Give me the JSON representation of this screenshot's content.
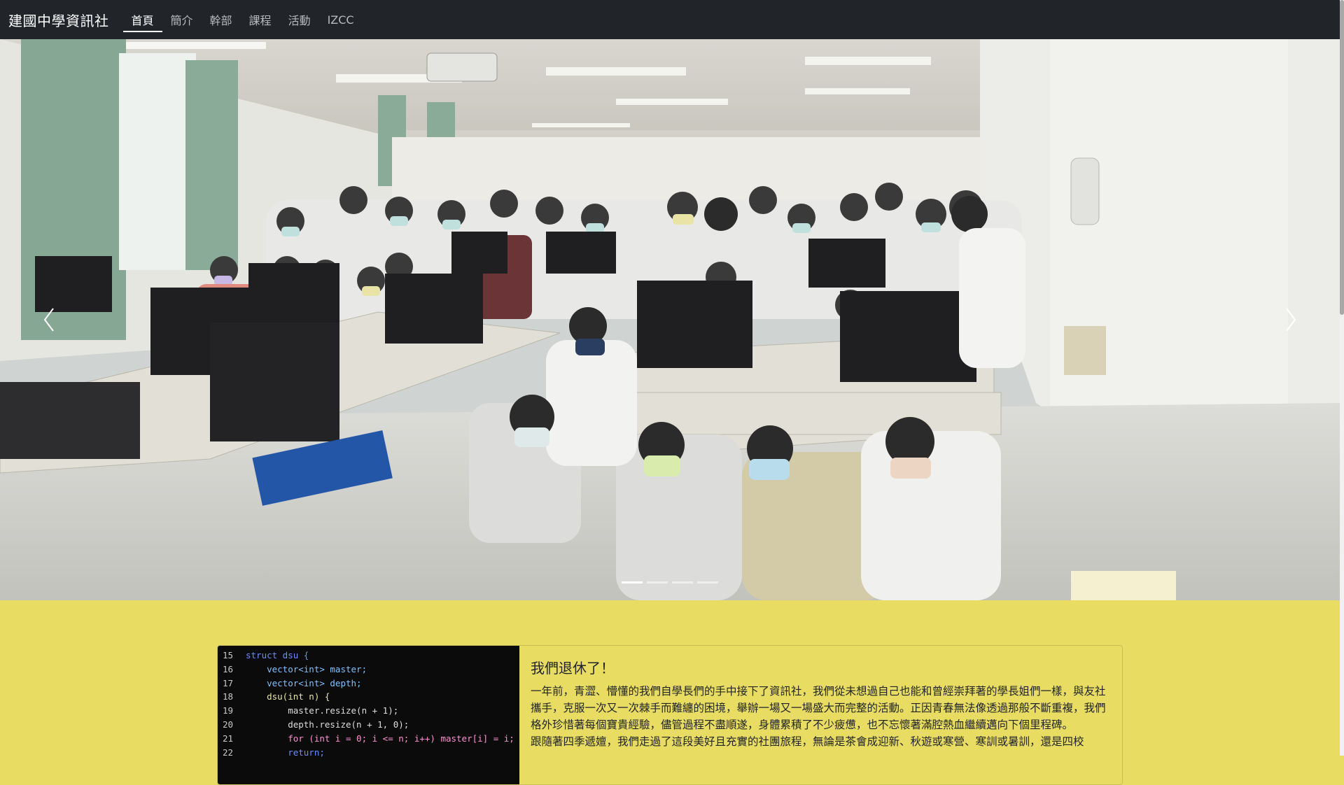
{
  "navbar": {
    "brand": "建國中學資訊社",
    "items": [
      {
        "label": "首頁",
        "active": true
      },
      {
        "label": "簡介",
        "active": false
      },
      {
        "label": "幹部",
        "active": false
      },
      {
        "label": "課程",
        "active": false
      },
      {
        "label": "活動",
        "active": false
      },
      {
        "label": "IZCC",
        "active": false
      }
    ]
  },
  "carousel": {
    "indicator_count": 4,
    "active_index": 0,
    "prev_icon": "chevron-left-icon",
    "next_icon": "chevron-right-icon"
  },
  "card": {
    "title": "我們退休了！",
    "paragraph": "一年前，青澀、懵懂的我們自學長們的手中接下了資訊社，我們從未想過自己也能和曾經崇拜著的學長姐們一樣，與友社攜手，克服一次又一次棘手而難纏的困境，舉辦一場又一場盛大而完整的活動。正因青春無法像透過那般不斷重複，我們格外珍惜著每個寶貴經驗，儘管過程不盡順遂，身體累積了不少疲憊，也不忘懷著滿腔熱血繼續邁向下個里程碑。",
    "paragraph2": "跟隨著四季遞嬗，我們走過了這段美好且充實的社團旅程，無論是茶會成迎新、秋遊或寒營、寒訓或暑訓，還是四校",
    "code_lines": [
      {
        "n": "15",
        "text": "struct dsu {"
      },
      {
        "n": "16",
        "text": "    vector<int> master;"
      },
      {
        "n": "17",
        "text": "    vector<int> depth;"
      },
      {
        "n": "18",
        "text": "    dsu(int n) {"
      },
      {
        "n": "19",
        "text": "        master.resize(n + 1);"
      },
      {
        "n": "20",
        "text": "        depth.resize(n + 1, 0);"
      },
      {
        "n": "21",
        "text": "        for (int i = 0; i <= n; i++) master[i] = i;"
      },
      {
        "n": "22",
        "text": "        return;"
      }
    ]
  },
  "colors": {
    "navbar_bg": "#212529",
    "page_bg": "#e9dc63"
  }
}
